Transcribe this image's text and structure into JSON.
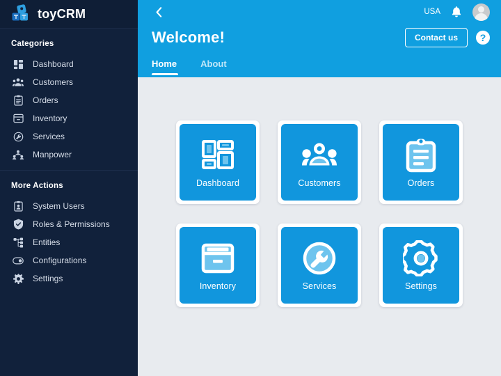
{
  "colors": {
    "sidebar_bg": "#11213b",
    "header_blue": "#109fe0",
    "tile_blue": "#1196dd",
    "content_bg": "#e8ebef",
    "tile_card": "#ffffff"
  },
  "brand": {
    "name": "toyCRM",
    "logo_icon": "toy-blocks-logo-icon"
  },
  "sidebar": {
    "sections": [
      {
        "title": "Categories",
        "items": [
          {
            "label": "Dashboard",
            "icon": "dashboard-grid-icon"
          },
          {
            "label": "Customers",
            "icon": "people-group-icon"
          },
          {
            "label": "Orders",
            "icon": "clipboard-icon"
          },
          {
            "label": "Inventory",
            "icon": "box-icon"
          },
          {
            "label": "Services",
            "icon": "wrench-circle-icon"
          },
          {
            "label": "Manpower",
            "icon": "manpower-network-icon"
          }
        ]
      },
      {
        "title": "More Actions",
        "items": [
          {
            "label": "System Users",
            "icon": "id-badge-icon"
          },
          {
            "label": "Roles & Permissions",
            "icon": "shield-check-icon"
          },
          {
            "label": "Entities",
            "icon": "sitemap-icon"
          },
          {
            "label": "Configurations",
            "icon": "toggle-switch-icon"
          },
          {
            "label": "Settings",
            "icon": "gear-icon"
          }
        ]
      }
    ]
  },
  "header": {
    "back_icon": "chevron-left-icon",
    "locale": "USA",
    "bell_icon": "notification-bell-icon",
    "avatar_icon": "user-avatar",
    "title": "Welcome!",
    "contact_label": "Contact us",
    "help_label": "?",
    "help_icon": "help-question-icon",
    "tabs": [
      {
        "label": "Home",
        "active": true
      },
      {
        "label": "About",
        "active": false
      }
    ]
  },
  "main": {
    "tiles": [
      {
        "label": "Dashboard",
        "icon": "dashboard-grid-icon"
      },
      {
        "label": "Customers",
        "icon": "people-group-icon"
      },
      {
        "label": "Orders",
        "icon": "clipboard-icon"
      },
      {
        "label": "Inventory",
        "icon": "box-icon"
      },
      {
        "label": "Services",
        "icon": "wrench-circle-icon"
      },
      {
        "label": "Settings",
        "icon": "gear-icon"
      }
    ]
  }
}
